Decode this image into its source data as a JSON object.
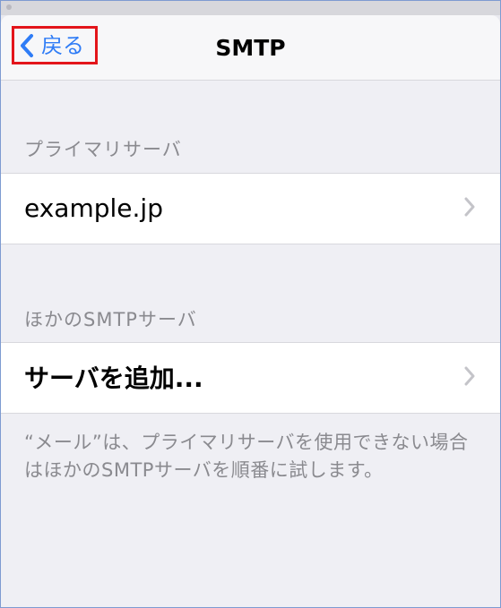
{
  "navbar": {
    "back_label": "戻る",
    "title": "SMTP"
  },
  "primary_section": {
    "header": "プライマリサーバ",
    "server": "example.jp"
  },
  "other_section": {
    "header": "ほかのSMTPサーバ",
    "add_label": "サーバを追加..."
  },
  "footer": {
    "note": "“メール”は、プライマリサーバを使用できない場合はほかのSMTPサーバを順番に試します。"
  },
  "colors": {
    "accent": "#2f7cf6",
    "highlight": "#e3151b",
    "background": "#efeff4",
    "secondary_text": "#8a8a8f"
  },
  "icons": {
    "back": "chevron-left-icon",
    "disclosure": "chevron-right-icon"
  }
}
